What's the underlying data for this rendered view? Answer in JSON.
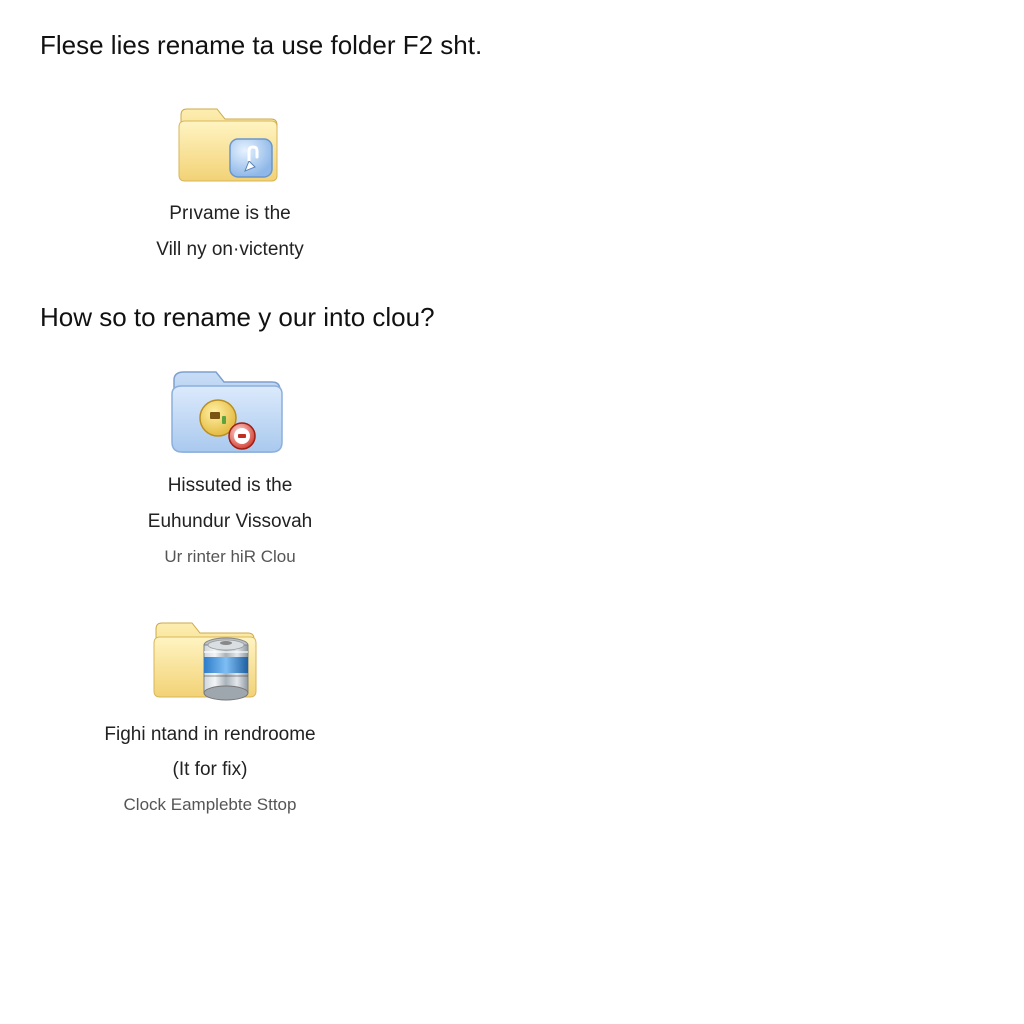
{
  "headings": {
    "h1": "Flese lies rename ta use folder F2 sht.",
    "h2": "How so to rename y our into clou?"
  },
  "items": [
    {
      "label_line1": "Prıvame is the",
      "label_line2": "Vill ny on·victenty"
    },
    {
      "label_line1": "Hissuted is the",
      "label_line2": "Euhundur Vissovah",
      "sublabel": "Ur rinter hiR Clou"
    },
    {
      "label_line1": "Fighi ntand in rendroome",
      "label_line2": "(It for fix)",
      "sublabel": "Clock Eamplebte Sttop"
    }
  ]
}
